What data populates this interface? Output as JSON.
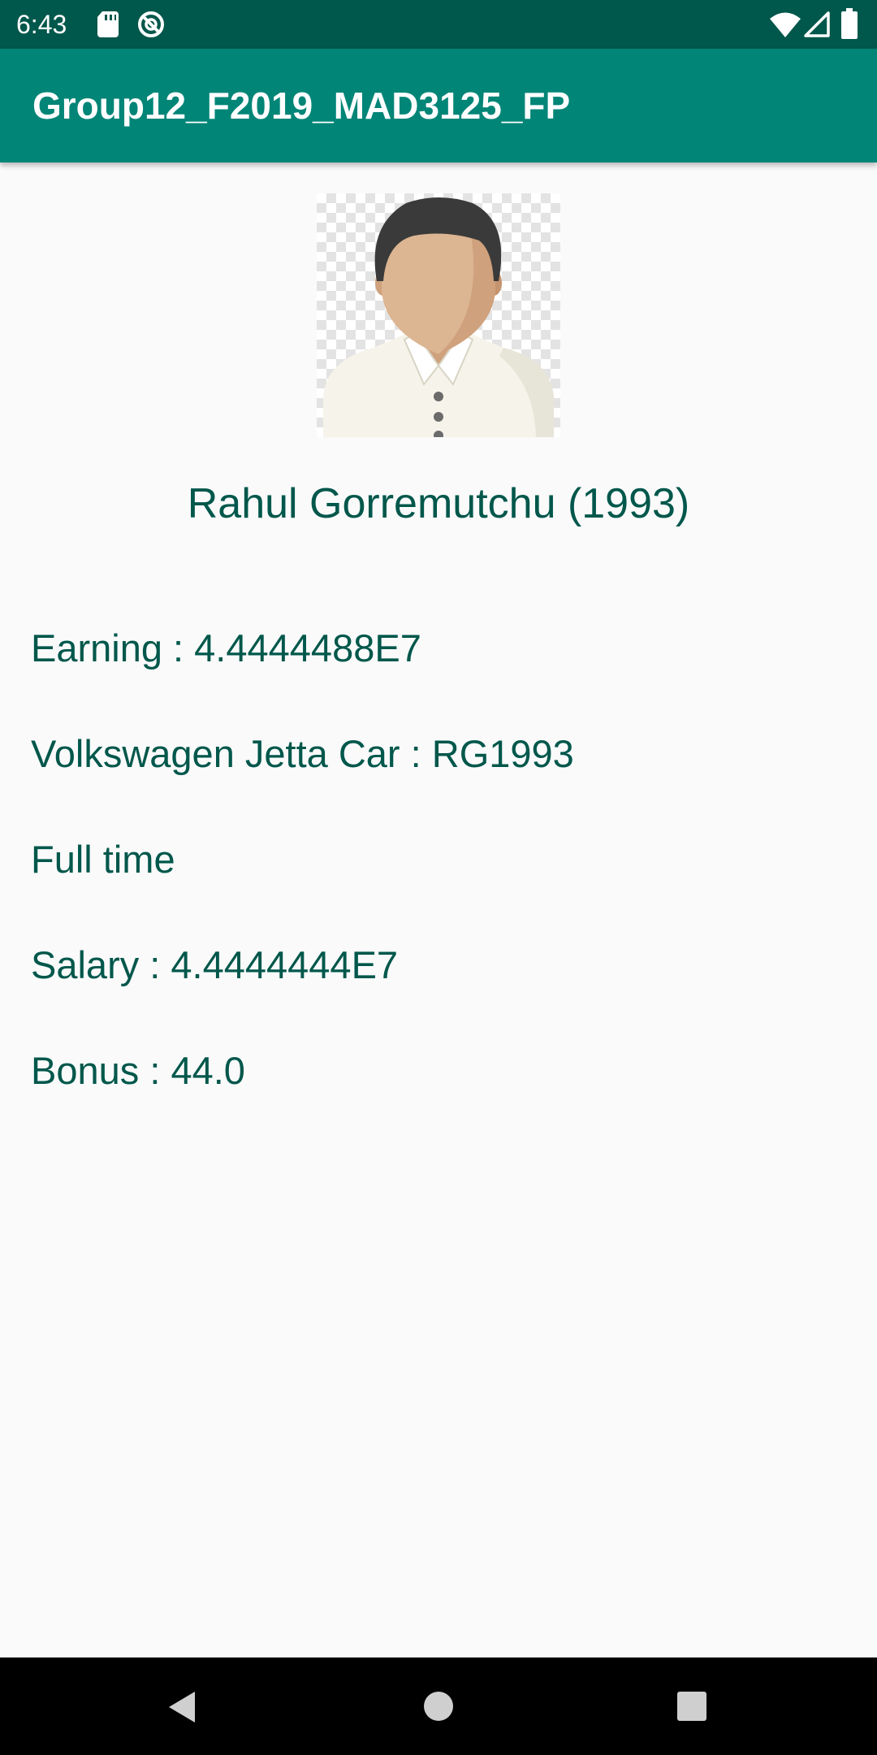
{
  "status_bar": {
    "time": "6:43",
    "icons": [
      "sd-card-icon",
      "do-not-disturb-icon",
      "wifi-icon",
      "cell-signal-icon",
      "battery-icon"
    ]
  },
  "app_bar": {
    "title": "Group12_F2019_MAD3125_FP"
  },
  "profile": {
    "avatar_icon": "person-avatar-icon",
    "name": "Rahul Gorremutchu (1993)"
  },
  "details": {
    "earning": "Earning : 4.4444488E7",
    "vehicle": "Volkswagen Jetta Car : RG1993",
    "employment_type": "Full time",
    "salary": "Salary : 4.4444444E7",
    "bonus": "Bonus : 44.0"
  },
  "nav_bar": {
    "icons": [
      "back-icon",
      "home-icon",
      "recents-icon"
    ]
  },
  "colors": {
    "status_bar": "#00574b",
    "app_bar": "#008577",
    "text_primary": "#00574b",
    "background": "#fafafa"
  }
}
